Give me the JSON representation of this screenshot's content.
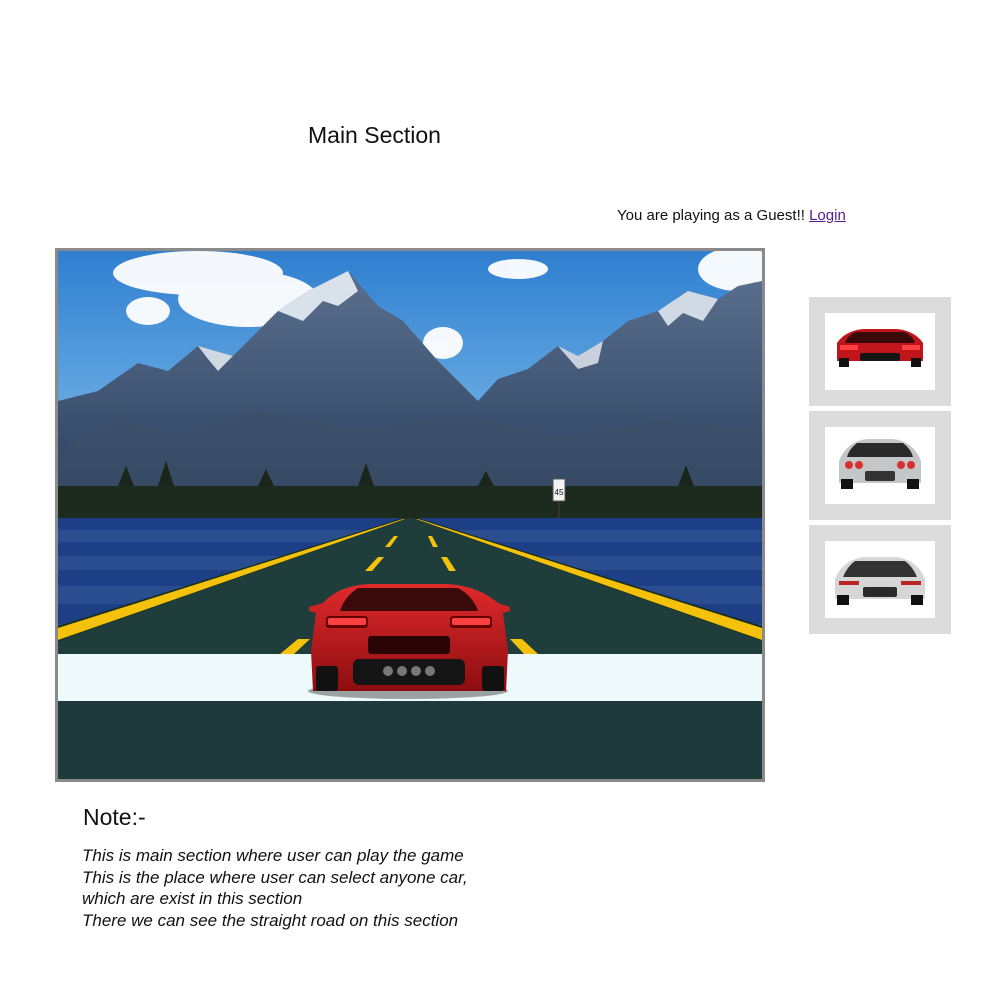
{
  "header": {
    "title": "Main Section"
  },
  "user": {
    "status_text": "You are playing as a Guest!!",
    "login_label": "Login"
  },
  "game": {
    "sign_text": "45",
    "colors": {
      "sky": "#3a8fd6",
      "road": "#1f3d3a",
      "lane_yellow": "#f4c20d",
      "water": "#1d3f86",
      "snow": "#eef9fb",
      "car_red": "#c0161b"
    }
  },
  "car_select": {
    "cars": [
      {
        "name": "red-car",
        "body": "#c0161b"
      },
      {
        "name": "silver-car",
        "body": "#c4c6c8"
      },
      {
        "name": "white-car",
        "body": "#d6d6d6"
      }
    ]
  },
  "note": {
    "title": "Note:-",
    "lines": [
      "This is main section where user can play the game",
      "This is the place where user can select anyone car,",
      "which are exist in this section",
      "There we can see the straight road on this section"
    ]
  }
}
